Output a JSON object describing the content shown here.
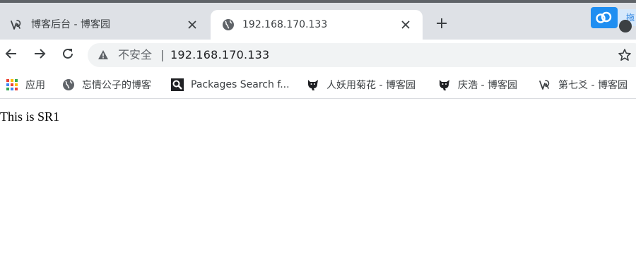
{
  "tabs": [
    {
      "title": "博客后台 - 博客园",
      "favicon": "cnblogs-icon",
      "active": false
    },
    {
      "title": "192.168.170.133",
      "favicon": "globe-icon",
      "active": true
    }
  ],
  "new_tab_icon": "plus-icon",
  "extension": {
    "icon": "baidu-netdisk-icon",
    "label": "拖"
  },
  "navigation": {
    "back_icon": "back-arrow-icon",
    "forward_icon": "forward-arrow-icon",
    "reload_icon": "reload-icon"
  },
  "omnibox": {
    "security_icon": "warning-triangle-icon",
    "security_text": "不安全",
    "separator": "|",
    "url": "192.168.170.133",
    "bookmark_icon": "star-icon"
  },
  "bookmarks": [
    {
      "label": "应用",
      "icon": "apps-grid-icon"
    },
    {
      "label": "忘情公子的博客",
      "icon": "globe-icon"
    },
    {
      "label": "Packages Search f...",
      "icon": "magnifier-icon"
    },
    {
      "label": "人妖用菊花 - 博客园",
      "icon": "cat-icon"
    },
    {
      "label": "庆浩 - 博客园",
      "icon": "cat-icon"
    },
    {
      "label": "第七爻 - 博客园",
      "icon": "cnblogs-icon"
    }
  ],
  "page": {
    "body_text": "This is SR1"
  },
  "colors": {
    "tabstrip_bg": "#dee1e6",
    "omnibox_bg": "#f1f3f4",
    "extension_blue": "#1f8ef1"
  }
}
